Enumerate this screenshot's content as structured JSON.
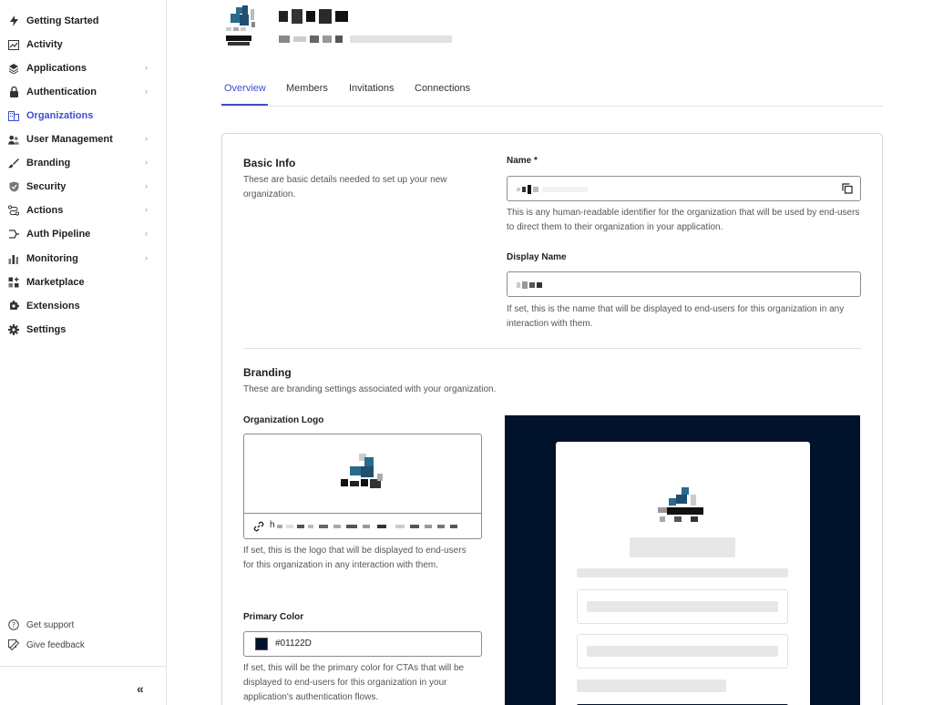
{
  "sidebar": {
    "items": [
      {
        "label": "Getting Started",
        "icon": "bolt-icon",
        "has_chevron": false,
        "active": false
      },
      {
        "label": "Activity",
        "icon": "activity-chart-icon",
        "has_chevron": false,
        "active": false
      },
      {
        "label": "Applications",
        "icon": "layers-icon",
        "has_chevron": true,
        "active": false
      },
      {
        "label": "Authentication",
        "icon": "lock-icon",
        "has_chevron": true,
        "active": false
      },
      {
        "label": "Organizations",
        "icon": "building-icon",
        "has_chevron": false,
        "active": true
      },
      {
        "label": "User Management",
        "icon": "users-icon",
        "has_chevron": true,
        "active": false
      },
      {
        "label": "Branding",
        "icon": "brush-icon",
        "has_chevron": true,
        "active": false
      },
      {
        "label": "Security",
        "icon": "shield-icon",
        "has_chevron": true,
        "active": false
      },
      {
        "label": "Actions",
        "icon": "flow-icon",
        "has_chevron": true,
        "active": false
      },
      {
        "label": "Auth Pipeline",
        "icon": "pipeline-icon",
        "has_chevron": true,
        "active": false
      },
      {
        "label": "Monitoring",
        "icon": "bar-chart-icon",
        "has_chevron": true,
        "active": false
      },
      {
        "label": "Marketplace",
        "icon": "grid-plus-icon",
        "has_chevron": false,
        "active": false
      },
      {
        "label": "Extensions",
        "icon": "puzzle-icon",
        "has_chevron": false,
        "active": false
      },
      {
        "label": "Settings",
        "icon": "gear-icon",
        "has_chevron": false,
        "active": false
      }
    ],
    "footer": {
      "support_label": "Get support",
      "feedback_label": "Give feedback",
      "collapse_glyph": "«"
    }
  },
  "tabs": [
    {
      "label": "Overview",
      "active": true
    },
    {
      "label": "Members",
      "active": false
    },
    {
      "label": "Invitations",
      "active": false
    },
    {
      "label": "Connections",
      "active": false
    }
  ],
  "basic_info": {
    "title": "Basic Info",
    "description": "These are basic details needed to set up your new organization.",
    "name_label": "Name *",
    "name_help": "This is any human-readable identifier for the organization that will be used by end-users to direct them to their organization in your application.",
    "display_name_label": "Display Name",
    "display_name_help": "If set, this is the name that will be displayed to end-users for this organization in any interaction with them."
  },
  "branding": {
    "title": "Branding",
    "description": "These are branding settings associated with your organization.",
    "logo_label": "Organization Logo",
    "logo_url_prefix": "h",
    "logo_help": "If set, this is the logo that will be displayed to end-users for this organization in any interaction with them.",
    "primary_color_label": "Primary Color",
    "primary_color_value": "#01122D",
    "primary_color_help": "If set, this will be the primary color for CTAs that will be displayed to end-users for this organization in your application's authentication flows."
  },
  "colors": {
    "accent": "#3c4fd1",
    "preview_background": "#01122D",
    "logo_blue": "#2b6a8f"
  }
}
